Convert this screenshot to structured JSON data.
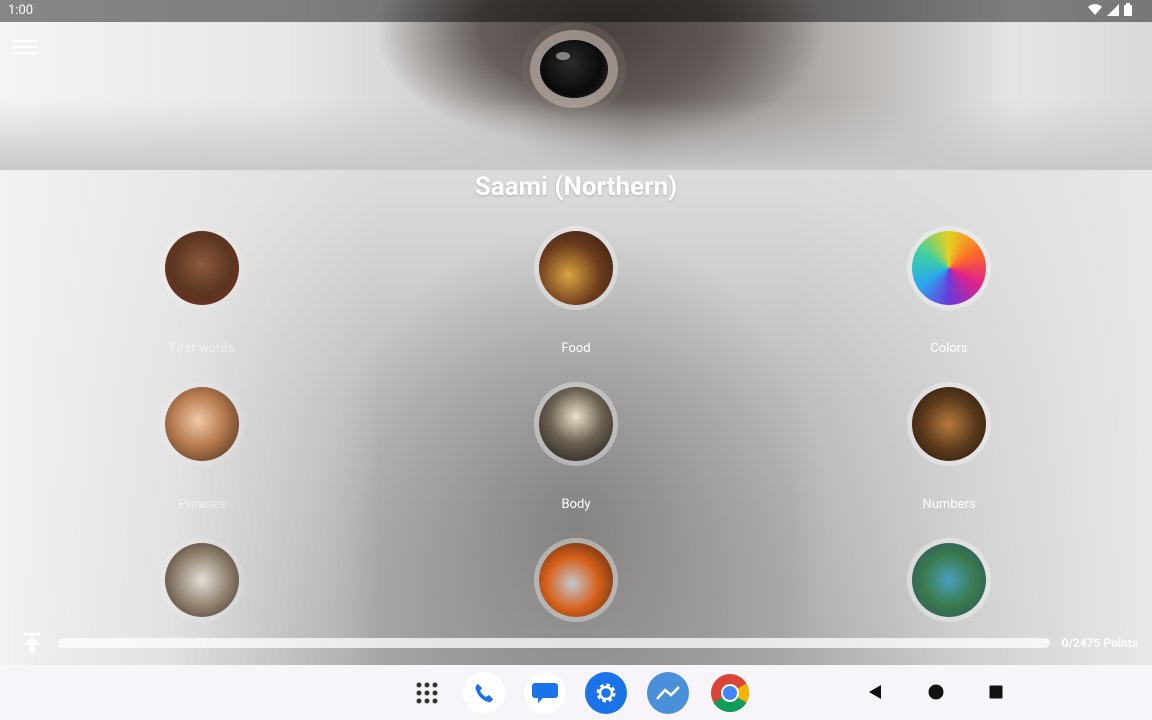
{
  "status_bar": {
    "time": "1:00"
  },
  "course": {
    "title": "Saami (Northern)"
  },
  "categories": [
    {
      "label": "First words"
    },
    {
      "label": "Food"
    },
    {
      "label": "Colors"
    },
    {
      "label": "Phrases"
    },
    {
      "label": "Body"
    },
    {
      "label": "Numbers"
    }
  ],
  "progress": {
    "points_text": "0/2475 Points",
    "fraction": 0
  },
  "colors": {
    "accent": "#4a90d9",
    "navbar_bg": "#f7f4fa"
  }
}
